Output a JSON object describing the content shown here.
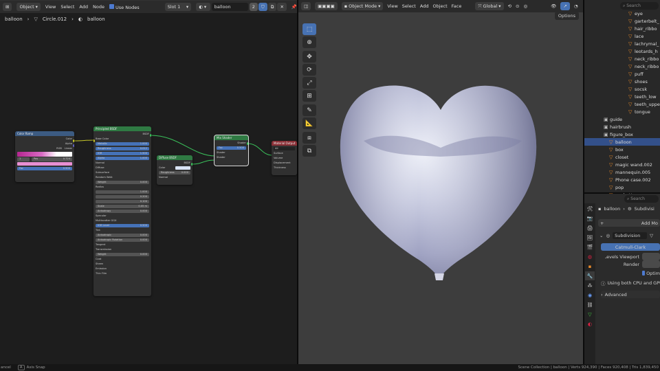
{
  "node_editor": {
    "header": {
      "editor_label": "Object",
      "menu": [
        "View",
        "Select",
        "Add",
        "Node"
      ],
      "use_nodes_label": "Use Nodes",
      "slot_label": "Slot 1",
      "material_name": "balloon",
      "user_count": "2"
    },
    "breadcrumb": [
      "balloon",
      "Circle.012",
      "balloon"
    ],
    "nodes": {
      "color_ramp": {
        "title": "Color Ramp",
        "out_color": "Color",
        "out_alpha": "Alpha",
        "mode": "RGB",
        "interp": "Linear",
        "stop_index": "1",
        "pos_label": "Pos",
        "pos_value": "0.724",
        "fac_label": "Fac",
        "fac_value": "0.500"
      },
      "principled": {
        "title": "Principled BSDF",
        "bsdf_label": "BSDF",
        "rows": [
          {
            "label": "Base Color",
            "value": ""
          },
          {
            "label": "Metallic",
            "value": "1.000"
          },
          {
            "label": "Roughness",
            "value": "0.012"
          },
          {
            "label": "IOR",
            "value": "1.500"
          },
          {
            "label": "Alpha",
            "value": "1.000"
          },
          {
            "label": "Normal",
            "value": ""
          },
          {
            "label": "Diffuse",
            "value": ""
          },
          {
            "label": "Subsurface",
            "value": ""
          },
          {
            "label": "Random Walk",
            "value": ""
          },
          {
            "label": "Weight",
            "value": "0.000"
          },
          {
            "label": "Radius",
            "value": ""
          },
          {
            "label": "",
            "value": "1.000"
          },
          {
            "label": "",
            "value": "0.200"
          },
          {
            "label": "",
            "value": "0.100"
          },
          {
            "label": "Scale",
            "value": "0.05 m"
          },
          {
            "label": "Anisotropy",
            "value": "0.000"
          },
          {
            "label": "Specular",
            "value": ""
          },
          {
            "label": "Multiscatter GGX",
            "value": ""
          },
          {
            "label": "IOR Level",
            "value": "0.500"
          },
          {
            "label": "Tint",
            "value": ""
          },
          {
            "label": "Anisotropic",
            "value": "0.000"
          },
          {
            "label": "Anisotropic Rotation",
            "value": "0.000"
          },
          {
            "label": "Tangent",
            "value": ""
          },
          {
            "label": "Transmission",
            "value": ""
          },
          {
            "label": "Weight",
            "value": "0.000"
          },
          {
            "label": "Coat",
            "value": ""
          },
          {
            "label": "Sheen",
            "value": ""
          },
          {
            "label": "Emission",
            "value": ""
          },
          {
            "label": "Thin Film",
            "value": ""
          }
        ]
      },
      "diffuse": {
        "title": "Diffuse BSDF",
        "bsdf_label": "BSDF",
        "color_label": "Color",
        "roughness_label": "Roughness",
        "roughness_value": "0.000",
        "normal_label": "Normal"
      },
      "mix_shader": {
        "title": "Mix Shader",
        "out_label": "Shader",
        "fac_label": "Fac",
        "fac_value": "0.500",
        "shader_a": "Shader",
        "shader_b": "Shader"
      },
      "material_output": {
        "title": "Material Output",
        "target": "All",
        "inputs": [
          "Surface",
          "Volume",
          "Displacement",
          "Thickness"
        ]
      }
    }
  },
  "viewport": {
    "mode_label": "Object Mode",
    "menu": [
      "View",
      "Select",
      "Add",
      "Object",
      "Face"
    ],
    "orientation": "Global",
    "options_label": "Options",
    "tools": [
      "select-box",
      "cursor",
      "move",
      "rotate",
      "scale",
      "transform",
      "annotate",
      "measure",
      "add-cube",
      "extrude"
    ]
  },
  "outliner": {
    "search_placeholder": "Search",
    "items": [
      {
        "name": "eye",
        "kind": "mesh"
      },
      {
        "name": "garterbelt_",
        "kind": "mesh"
      },
      {
        "name": "hair_ribbo",
        "kind": "mesh"
      },
      {
        "name": "lace",
        "kind": "mesh"
      },
      {
        "name": "lachrymal_",
        "kind": "mesh"
      },
      {
        "name": "leotards_h",
        "kind": "mesh"
      },
      {
        "name": "neck_ribbo",
        "kind": "mesh"
      },
      {
        "name": "neck_ribbo",
        "kind": "mesh"
      },
      {
        "name": "puff",
        "kind": "mesh"
      },
      {
        "name": "shoes",
        "kind": "mesh"
      },
      {
        "name": "socsk",
        "kind": "mesh"
      },
      {
        "name": "teeth_low",
        "kind": "mesh"
      },
      {
        "name": "teeth_uppe",
        "kind": "mesh"
      },
      {
        "name": "tongue",
        "kind": "mesh"
      },
      {
        "name": "guide",
        "kind": "collection"
      },
      {
        "name": "hairbrush",
        "kind": "collection"
      },
      {
        "name": "figure_box",
        "kind": "collection"
      },
      {
        "name": "balloon",
        "kind": "mesh"
      },
      {
        "name": "box",
        "kind": "mesh"
      },
      {
        "name": "closet",
        "kind": "mesh"
      },
      {
        "name": "magic wand.002",
        "kind": "mesh"
      },
      {
        "name": "mannequin.005",
        "kind": "mesh"
      },
      {
        "name": "Phone case.002",
        "kind": "mesh"
      },
      {
        "name": "pop",
        "kind": "mesh"
      },
      {
        "name": "pochette",
        "kind": "mesh"
      }
    ]
  },
  "properties": {
    "search_placeholder": "Search",
    "object_name": "balloon",
    "modifier_crumb": "Subdivisi",
    "add_modifier_label": "Add Mo",
    "modifier_name": "Subdivision",
    "catmull_label": "Catmull-Clark",
    "levels_viewport_label": "Levels Viewport",
    "render_label": "Render",
    "optimal_label": "Optim",
    "info_text": "Using both CPU and GPU",
    "advanced_label": "Advanced"
  },
  "status_bar": {
    "left": "ancel",
    "axis_snap": "Axis Snap",
    "stats": "Scene Collection | balloon | Verts 924,390 | Faces 920,408 | Tris 1,839,450"
  }
}
